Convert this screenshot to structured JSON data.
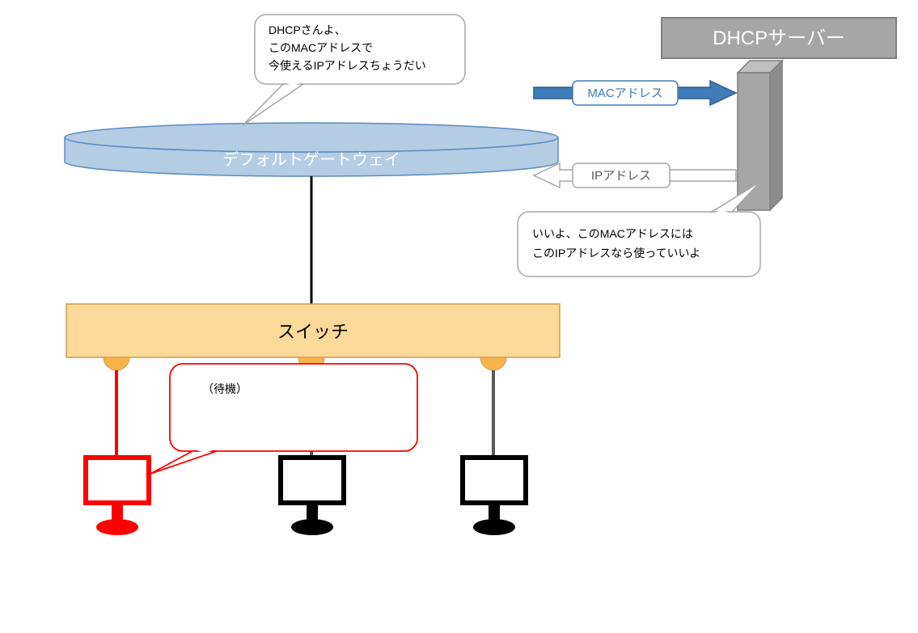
{
  "dhcpServer": {
    "title": "DHCPサーバー"
  },
  "gateway": {
    "label": "デフォルトゲートウェイ"
  },
  "switch": {
    "label": "スイッチ"
  },
  "balloons": {
    "gatewayRequest": {
      "line1": "DHCPさんよ、",
      "line2": "このMACアドレスで",
      "line3": "今使えるIPアドレスちょうだい"
    },
    "serverReply": {
      "line1": "いいよ、このMACアドレスには",
      "line2": "このIPアドレスなら使っていいよ"
    },
    "client": {
      "text": "（待機）"
    }
  },
  "arrows": {
    "toServer": {
      "label": "MACアドレス"
    },
    "fromServer": {
      "label": "IPアドレス"
    }
  },
  "colors": {
    "gatewayFill": "#B4CCE4",
    "gatewayStroke": "#5A8BC0",
    "switchFill": "#FBD999",
    "switchStroke": "#C89E4E",
    "dhcpHeaderFill": "#A6A6A6",
    "dhcpHeaderStroke": "#7F7F7F",
    "dhcpBoxFill": "#A6A6A6",
    "dhcpBoxStroke": "#7F7F7F",
    "arrowBlueFill": "#3F7DB9",
    "arrowBlueStroke": "#2F5E8A",
    "arrowWhiteStroke": "#A6A6A6",
    "clientRed": "#FF0000",
    "portFill": "#F8B44A"
  }
}
